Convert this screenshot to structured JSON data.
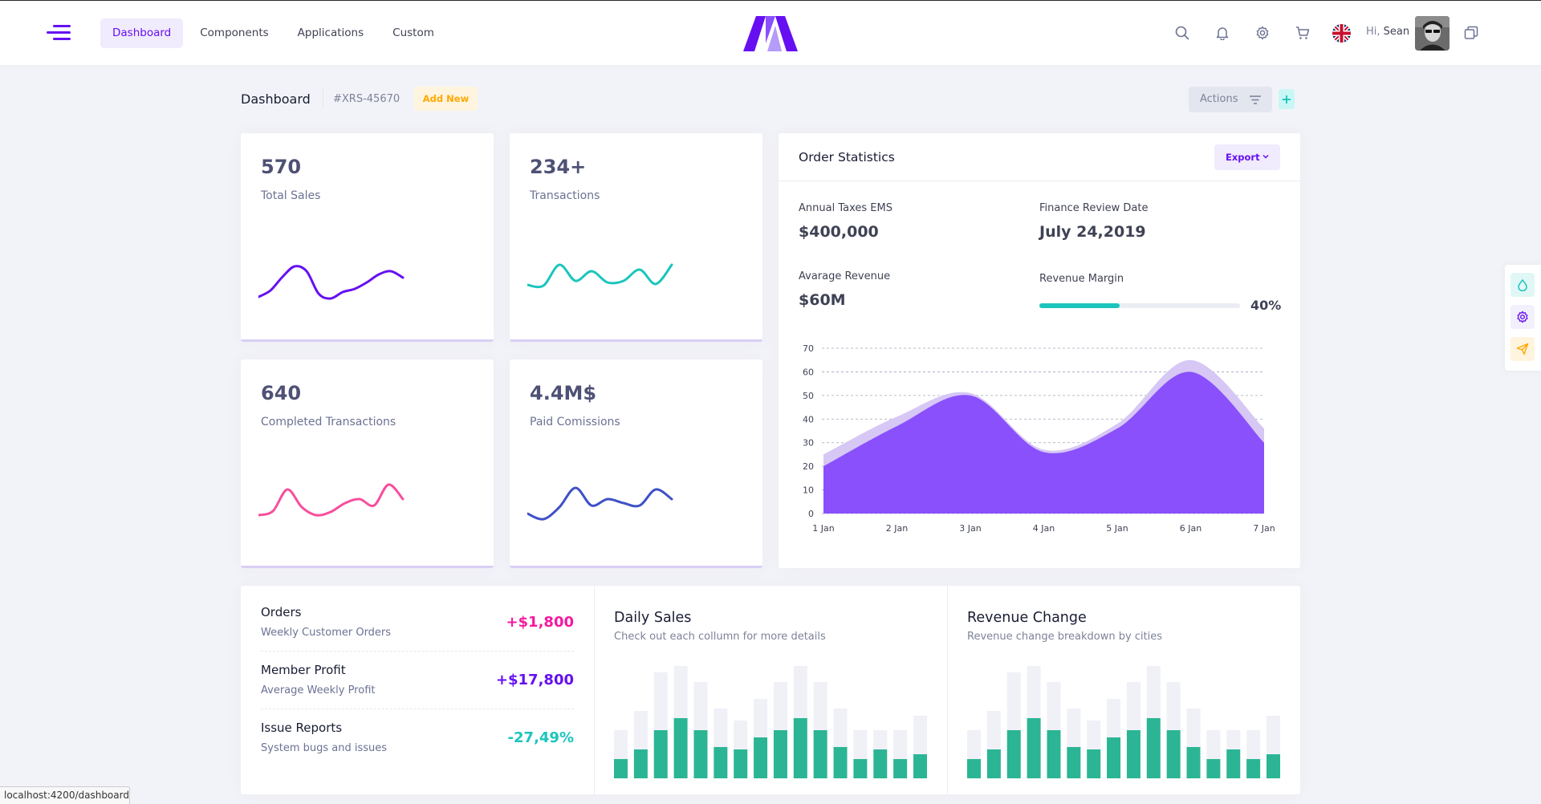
{
  "header": {
    "nav": [
      {
        "label": "Dashboard",
        "active": true
      },
      {
        "label": "Components",
        "active": false
      },
      {
        "label": "Applications",
        "active": false
      },
      {
        "label": "Custom",
        "active": false
      }
    ],
    "greeting_hi": "Hi,",
    "user_name": "Sean",
    "icons": [
      "menu-icon",
      "search-icon",
      "bell-icon",
      "gear-icon",
      "cart-icon",
      "uk-flag-icon",
      "avatar",
      "copy-icon"
    ]
  },
  "subheader": {
    "title": "Dashboard",
    "code": "#XRS-45670",
    "add_new": "Add New",
    "actions": "Actions"
  },
  "stats": [
    {
      "value": "570",
      "label": "Total Sales",
      "color": "#6610f2",
      "points": [
        30,
        38,
        55,
        68,
        62,
        34,
        28,
        36,
        40,
        48,
        58,
        62,
        54
      ]
    },
    {
      "value": "234+",
      "label": "Transactions",
      "color": "#1bc5bd",
      "points": [
        45,
        44,
        70,
        50,
        62,
        48,
        50,
        64,
        46,
        70
      ]
    },
    {
      "value": "640",
      "label": "Completed Transactions",
      "color": "#f64e9d",
      "points": [
        40,
        45,
        72,
        50,
        40,
        44,
        55,
        60,
        52,
        78,
        60
      ]
    },
    {
      "value": "4.4M$",
      "label": "Paid Comissions",
      "color": "#3f51c7",
      "points": [
        42,
        35,
        50,
        74,
        52,
        60,
        55,
        52,
        72,
        60
      ]
    }
  ],
  "order_statistics": {
    "title": "Order Statistics",
    "export": "Export",
    "annual_taxes_label": "Annual Taxes EMS",
    "annual_taxes_value": "$400,000",
    "finance_review_label": "Finance Review Date",
    "finance_review_value": "July 24,2019",
    "avg_revenue_label": "Avarage Revenue",
    "avg_revenue_value": "$60M",
    "revenue_margin_label": "Revenue Margin",
    "revenue_margin_pct": "40%",
    "revenue_margin_fraction": 0.4
  },
  "chart_data": [
    {
      "type": "area",
      "title": "",
      "categories": [
        "1 Jan",
        "2 Jan",
        "3 Jan",
        "4 Jan",
        "5 Jan",
        "6 Jan",
        "7 Jan"
      ],
      "series": [
        {
          "values": [
            25,
            41,
            51,
            27,
            38,
            65,
            36
          ],
          "color": "#d6c7f5"
        },
        {
          "values": [
            20,
            37,
            50,
            26,
            36,
            60,
            30
          ],
          "color": "#8950fc"
        }
      ],
      "ylim": [
        0,
        70
      ],
      "yticks": [
        "0",
        "10",
        "20",
        "30",
        "40",
        "50",
        "60",
        "70"
      ],
      "grid": true
    },
    {
      "type": "bar",
      "title": "Daily Sales",
      "subtitle": "Check out each collumn for more details",
      "series": [
        {
          "values": [
            8,
            12,
            20,
            25,
            20,
            13,
            12,
            17,
            20,
            25,
            20,
            13,
            8,
            12,
            8,
            10
          ]
        },
        {
          "values": [
            3,
            4,
            6,
            6,
            5,
            4,
            3,
            4,
            5,
            6,
            5,
            4,
            3,
            2,
            3,
            4
          ]
        }
      ]
    },
    {
      "type": "bar",
      "title": "Revenue Change",
      "subtitle": "Revenue change breakdown by cities",
      "series": [
        {
          "values": [
            8,
            12,
            20,
            25,
            20,
            13,
            12,
            17,
            20,
            25,
            20,
            13,
            8,
            12,
            8,
            10
          ]
        },
        {
          "values": [
            3,
            4,
            6,
            6,
            5,
            4,
            3,
            4,
            5,
            6,
            5,
            4,
            3,
            2,
            3,
            4
          ]
        }
      ]
    }
  ],
  "list": [
    {
      "title": "Orders",
      "desc": "Weekly Customer Orders",
      "amount": "+$1,800",
      "color": "#f51aa0"
    },
    {
      "title": "Member Profit",
      "desc": "Average Weekly Profit",
      "amount": "+$17,800",
      "color": "#6610f2"
    },
    {
      "title": "Issue Reports",
      "desc": "System bugs and issues",
      "amount": "-27,49%",
      "color": "#1bc5bd"
    }
  ],
  "statusbar": "localhost:4200/dashboard"
}
